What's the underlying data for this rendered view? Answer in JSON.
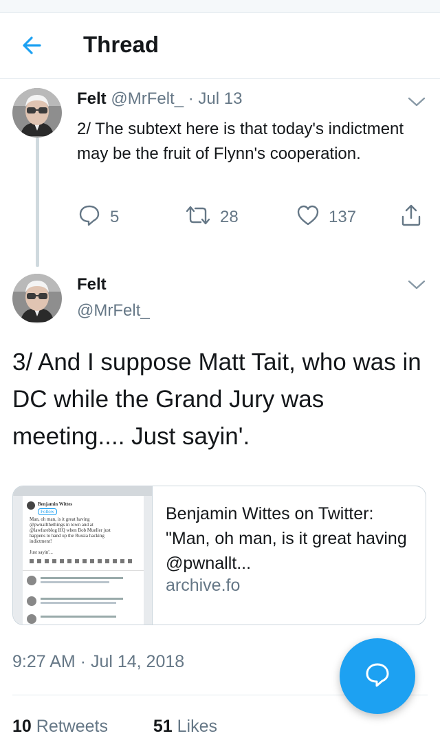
{
  "header": {
    "title": "Thread"
  },
  "tweet1": {
    "name": "Felt",
    "handle": "@MrFelt_",
    "separator": "·",
    "date": "Jul 13",
    "text": "2/ The subtext here is that today's indictment may be the fruit of Flynn's cooperation.",
    "replies": "5",
    "retweets": "28",
    "likes": "137"
  },
  "tweet2": {
    "name": "Felt",
    "handle": "@MrFelt_",
    "text": "3/ And I suppose Matt Tait, who was in DC while the Grand Jury was meeting.... Just sayin'.",
    "card": {
      "title": "Benjamin Wittes on Twitter: \"Man, oh man, is it great having @pwnallt...",
      "domain": "archive.fo",
      "preview": {
        "name": "Benjamin Wittes",
        "button": "Follow",
        "lines": [
          "Man, oh man, is it great having",
          "@pwnallthethings in town and at",
          "@lawfareblog HQ when Bob Mueller just",
          "happens to hand up the Russia hacking",
          "indictment!"
        ],
        "sayin": "Just sayin'..."
      }
    },
    "timestamp": "9:27 AM · Jul 14, 2018",
    "retweet_count": "10",
    "retweet_label": "Retweets",
    "like_count": "51",
    "like_label": "Likes"
  },
  "colors": {
    "accent": "#1da1f2",
    "muted": "#657786",
    "text": "#14171a"
  }
}
